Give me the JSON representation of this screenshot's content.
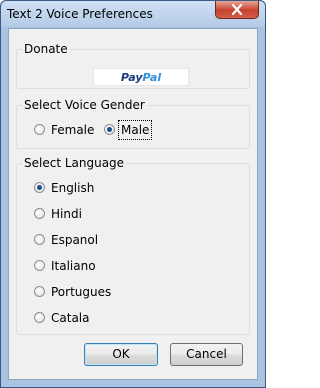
{
  "window": {
    "title": "Text 2 Voice Preferences"
  },
  "donate": {
    "group_label": "Donate",
    "paypal_part1": "Pay",
    "paypal_part2": "Pal"
  },
  "gender": {
    "group_label": "Select Voice Gender",
    "options": [
      {
        "label": "Female",
        "selected": false
      },
      {
        "label": "Male",
        "selected": true
      }
    ]
  },
  "language": {
    "group_label": "Select Language",
    "options": [
      {
        "label": "English",
        "selected": true
      },
      {
        "label": "Hindi",
        "selected": false
      },
      {
        "label": "Espanol",
        "selected": false
      },
      {
        "label": "Italiano",
        "selected": false
      },
      {
        "label": "Portugues",
        "selected": false
      },
      {
        "label": "Catala",
        "selected": false
      }
    ]
  },
  "buttons": {
    "ok_label": "OK",
    "cancel_label": "Cancel"
  }
}
